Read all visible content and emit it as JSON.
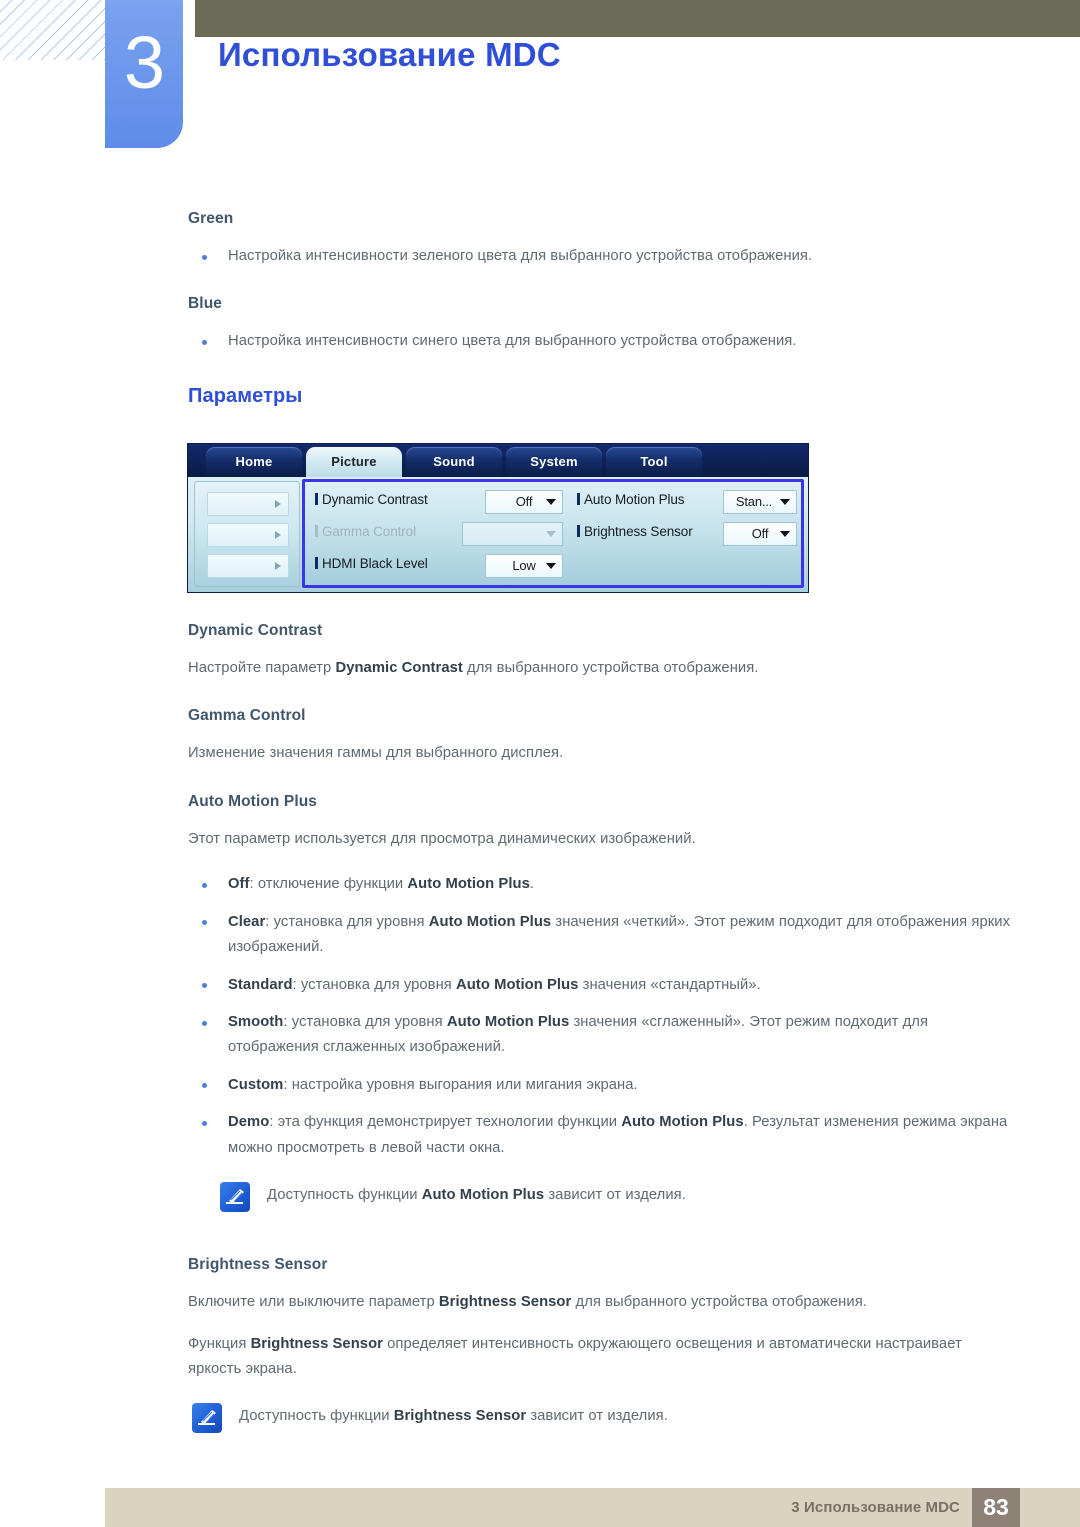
{
  "header": {
    "chapter_number": "3",
    "chapter_title": "Использование MDC"
  },
  "sections": {
    "green": {
      "heading": "Green",
      "bullet": "Настройка интенсивности зеленого цвета для выбранного устройства отображения."
    },
    "blue": {
      "heading": "Blue",
      "bullet": "Настройка интенсивности синего цвета для выбранного устройства отображения."
    },
    "parameters_heading": "Параметры",
    "dynamic_contrast": {
      "heading": "Dynamic Contrast",
      "body_pre": "Настройте параметр ",
      "body_bold": "Dynamic Contrast",
      "body_post": " для выбранного устройства отображения."
    },
    "gamma_control": {
      "heading": "Gamma Control",
      "body": "Изменение значения гаммы для выбранного дисплея."
    },
    "auto_motion_plus": {
      "heading": "Auto Motion Plus",
      "body": "Этот параметр используется для просмотра динамических изображений.",
      "options": [
        {
          "name": "Off",
          "pre": ": отключение функции ",
          "bold": "Auto Motion Plus",
          "post": "."
        },
        {
          "name": "Clear",
          "pre": ": установка для уровня ",
          "bold": "Auto Motion Plus",
          "post": " значения «четкий». Этот режим подходит для отображения ярких изображений."
        },
        {
          "name": "Standard",
          "pre": ": установка для уровня ",
          "bold": "Auto Motion Plus",
          "post": " значения «стандартный»."
        },
        {
          "name": "Smooth",
          "pre": ": установка для уровня ",
          "bold": "Auto Motion Plus",
          "post": " значения «сглаженный». Этот режим подходит для отображения сглаженных изображений."
        },
        {
          "name": "Custom",
          "pre": ": настройка уровня выгорания или мигания экрана.",
          "bold": "",
          "post": ""
        },
        {
          "name": "Demo",
          "pre": ": эта функция демонстрирует технологии функции ",
          "bold": "Auto Motion Plus",
          "post": ". Результат изменения режима экрана можно просмотреть в левой части окна."
        }
      ],
      "note": {
        "pre": "Доступность функции ",
        "bold": "Auto Motion Plus",
        "post": " зависит от изделия.",
        "icon": "note-pen-icon"
      }
    },
    "brightness_sensor": {
      "heading": "Brightness Sensor",
      "body1_pre": "Включите или выключите параметр ",
      "body1_bold": "Brightness Sensor",
      "body1_post": " для выбранного устройства отображения.",
      "body2_pre": "Функция ",
      "body2_bold": "Brightness Sensor",
      "body2_post": " определяет интенсивность окружающего освещения и автоматически настраивает яркость экрана.",
      "note": {
        "pre": "Доступность функции ",
        "bold": "Brightness Sensor",
        "post": " зависит от изделия.",
        "icon": "note-pen-icon"
      }
    }
  },
  "mdc_screenshot": {
    "tabs": [
      {
        "label": "Home",
        "active": false
      },
      {
        "label": "Picture",
        "active": true
      },
      {
        "label": "Sound",
        "active": false
      },
      {
        "label": "System",
        "active": false
      },
      {
        "label": "Tool",
        "active": false
      }
    ],
    "left_stubs": [
      "",
      "",
      ""
    ],
    "controls_left": [
      {
        "label": "Dynamic Contrast",
        "value": "Off",
        "disabled": false
      },
      {
        "label": "Gamma Control",
        "value": "",
        "disabled": true
      },
      {
        "label": "HDMI Black Level",
        "value": "Low",
        "disabled": false
      }
    ],
    "controls_right": [
      {
        "label": "Auto Motion Plus",
        "value": "Stan...",
        "disabled": false
      },
      {
        "label": "Brightness Sensor",
        "value": "Off",
        "disabled": false
      }
    ]
  },
  "footer": {
    "text": "3 Использование MDC",
    "page": "83"
  },
  "colors": {
    "chapter_blue": "#2f4fd8",
    "olive": "#6c6b57",
    "heading_gray": "#40576b",
    "body_gray": "#5e6a72",
    "bullet": "#4a7fe0",
    "footer_bar": "#d8d4c0",
    "footer_page_box": "#8d8275",
    "panel_highlight": "#3a35e8"
  }
}
